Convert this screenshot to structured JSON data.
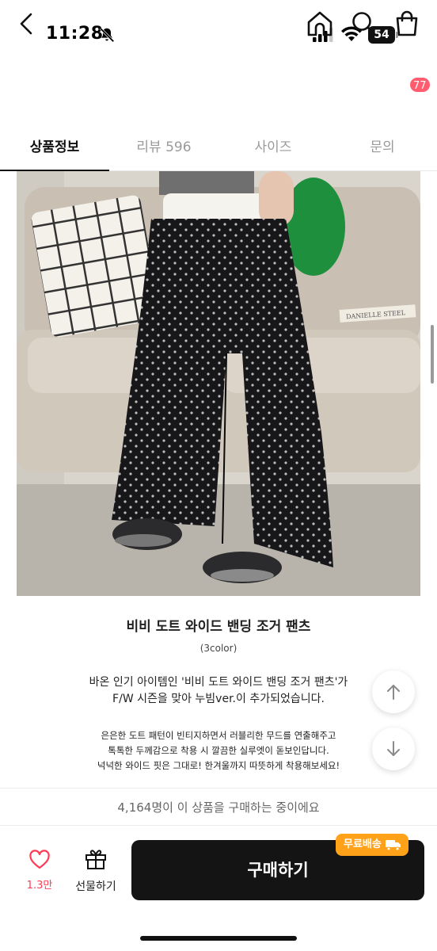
{
  "status_bar": {
    "time": "11:28",
    "battery": "54"
  },
  "cart": {
    "badge_count": "77"
  },
  "tabs": [
    {
      "label": "상품정보",
      "active": true
    },
    {
      "label": "리뷰 596",
      "active": false
    },
    {
      "label": "사이즈",
      "active": false
    },
    {
      "label": "문의",
      "active": false
    }
  ],
  "description": {
    "product_name": "비비 도트 와이드 밴딩 조거 팬츠",
    "color_count": "(3color)",
    "intro_lines": [
      "바온 인기 아이템인 '비비 도트 와이드 밴딩 조거 팬츠'가",
      "F/W 시즌을 맞아 누빔ver.이 추가되었습니다."
    ],
    "detail_lines": [
      "은은한 도트 패턴이 빈티지하면서 러블리한 무드를 연출해주고",
      "톡톡한 두께감으로 착용 시 깔끔한 실루엣이 돋보인답니다.",
      "넉넉한 와이드 핏은 그대로! 한겨울까지 따뜻하게 착용해보세요!"
    ]
  },
  "photo": {
    "book_label": "DANIELLE STEEL"
  },
  "purchase_notice": "4,164명이 이 상품을 구매하는 중이에요",
  "bottom_bar": {
    "like_count": "1.3만",
    "gift_label": "선물하기",
    "buy_label": "구매하기",
    "free_shipping_label": "무료배송"
  },
  "colors": {
    "accent_pink": "#ff3b55",
    "badge_orange": "#ffa21a",
    "buy_button": "#141414"
  }
}
